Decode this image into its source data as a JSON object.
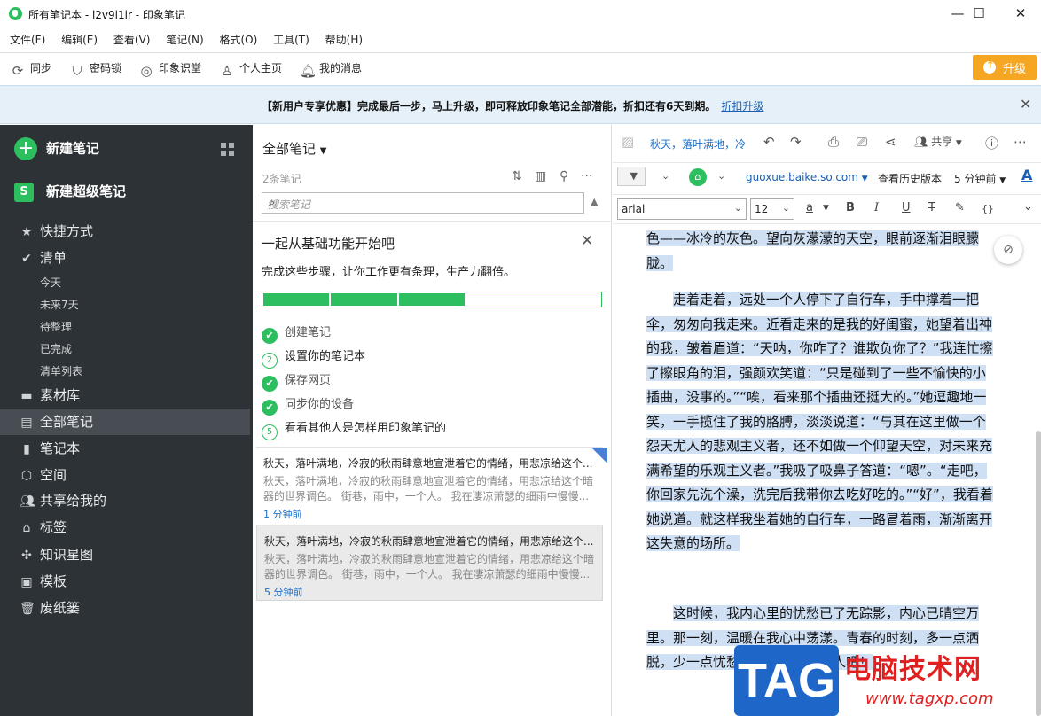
{
  "window": {
    "title": "所有笔记本 - l2v9i1ir - 印象笔记",
    "controls": {
      "minimize": "—",
      "maximize": "☐",
      "close": "✕"
    }
  },
  "menubar": [
    "文件(F)",
    "编辑(E)",
    "查看(V)",
    "笔记(N)",
    "格式(O)",
    "工具(T)",
    "帮助(H)"
  ],
  "toolbar": {
    "items": [
      {
        "label": "同步",
        "icon": "sync-icon"
      },
      {
        "label": "密码锁",
        "icon": "shield-icon"
      },
      {
        "label": "印象识堂",
        "icon": "target-icon"
      },
      {
        "label": "个人主页",
        "icon": "user-icon"
      },
      {
        "label": "我的消息",
        "icon": "bell-icon"
      }
    ],
    "upgrade_label": "升级"
  },
  "banner": {
    "text": "【新用户专享优惠】完成最后一步，马上升级，即可释放印象笔记全部潜能，折扣还有6天到期。",
    "link": "折扣升级"
  },
  "sidebar": {
    "new_note": "新建笔记",
    "new_super_note": "新建超级笔记",
    "items": [
      {
        "label": "快捷方式"
      },
      {
        "label": "清单"
      },
      {
        "label": "素材库"
      },
      {
        "label": "全部笔记"
      },
      {
        "label": "笔记本"
      },
      {
        "label": "空间"
      },
      {
        "label": "共享给我的"
      },
      {
        "label": "标签"
      },
      {
        "label": "知识星图"
      },
      {
        "label": "模板"
      },
      {
        "label": "废纸篓"
      }
    ],
    "sub_items": [
      "今天",
      "未来7天",
      "待整理",
      "已完成",
      "清单列表"
    ]
  },
  "notelist": {
    "title": "全部笔记",
    "count": "2条笔记",
    "search_placeholder": "搜索笔记",
    "onboarding": {
      "title": "一起从基础功能开始吧",
      "subtitle": "完成这些步骤，让你工作更有条理，生产力翻倍。",
      "progress": 0.6,
      "steps": [
        {
          "label": "创建笔记",
          "done": true,
          "num": "1"
        },
        {
          "label": "设置你的笔记本",
          "done": false,
          "num": "2"
        },
        {
          "label": "保存网页",
          "done": true,
          "num": "3"
        },
        {
          "label": "同步你的设备",
          "done": true,
          "num": "4"
        },
        {
          "label": "看看其他人是怎样用印象笔记的",
          "done": false,
          "num": "5"
        }
      ]
    },
    "notes": [
      {
        "title": "秋天，落叶满地，冷寂的秋雨肆意地宣泄着它的情绪，用悲凉给这个...",
        "snippet": "秋天，落叶满地，冷寂的秋雨肆意地宣泄着它的情绪，用悲凉给这个暗器的世界调色。 街巷，雨中，一个人。 我在凄凉萧瑟的细雨中慢慢...",
        "date": "1 分钟前"
      },
      {
        "title": "秋天，落叶满地，冷寂的秋雨肆意地宣泄着它的情绪，用悲凉给这个...",
        "snippet": "秋天，落叶满地，冷寂的秋雨肆意地宣泄着它的情绪，用悲凉给这个暗器的世界调色。 街巷，雨中，一个人。 我在凄凉萧瑟的细雨中慢慢...",
        "date": "5 分钟前"
      }
    ]
  },
  "editor": {
    "title": "秋天，落叶满地，冷",
    "share_label": "共享",
    "source": "guoxue.baike.so.com",
    "history": "查看历史版本",
    "time": "5 分钟前",
    "font": "arial",
    "size": "12",
    "format_buttons": [
      "a",
      "B",
      "I",
      "U",
      "T",
      "✎",
      "{}"
    ],
    "paragraphs": [
      "色——冰冷的灰色。望向灰濛濛的天空，眼前逐渐泪眼朦胧。",
      "走着走着，远处一个人停下了自行车，手中撑着一把伞，匆匆向我走来。近看走来的是我的好闺蜜，她望着出神的我，皱着眉道：“天呐，你咋了？谁欺负你了？”我连忙擦了擦眼角的泪，强颜欢笑道：“只是碰到了一些不愉快的小插曲，没事的。”“唉，看来那个插曲还挺大的。”她逗趣地一笑，一手揽住了我的胳膊，淡淡说道：“与其在这里做一个怨天尤人的悲观主义者，还不如做一个仰望天空，对未来充满希望的乐观主义者。”我吸了吸鼻子答道：“嗯”。“走吧，你回家先洗个澡，洗完后我带你去吃好吃的。”“好”，我看着她说道。就这样我坐着她的自行车，一路冒着雨，渐渐离开这失意的场所。",
      "这时候，我内心里的忧愁已了无踪影，内心已晴空万里。那一刻，温暖在我心中荡漾。青春的时刻，多一点洒脱，少一点忧愁，做一个快乐的人吧！"
    ]
  },
  "watermark": {
    "logo": "TAG",
    "name": "电脑技术网",
    "url": "www.tagxp.com"
  }
}
